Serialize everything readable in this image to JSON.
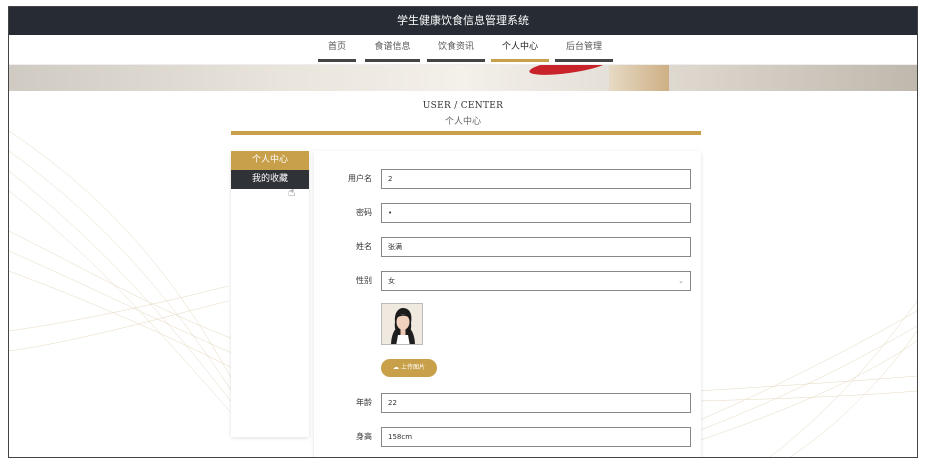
{
  "app": {
    "title": "学生健康饮食信息管理系统"
  },
  "nav": {
    "items": [
      {
        "label": "首页",
        "active": false
      },
      {
        "label": "食谱信息",
        "active": false
      },
      {
        "label": "饮食资讯",
        "active": false
      },
      {
        "label": "个人中心",
        "active": true
      },
      {
        "label": "后台管理",
        "active": false
      }
    ]
  },
  "section": {
    "title_en": "USER / CENTER",
    "title_cn": "个人中心"
  },
  "sidebar": {
    "items": [
      {
        "label": "个人中心"
      },
      {
        "label": "我的收藏"
      }
    ]
  },
  "form": {
    "username": {
      "label": "用户名",
      "value": "2"
    },
    "password": {
      "label": "密码",
      "value": "•"
    },
    "name": {
      "label": "姓名",
      "value": "张满"
    },
    "gender": {
      "label": "性别",
      "value": "女",
      "arrow": "⌄"
    },
    "upload": {
      "label": "上传图片",
      "icon": "cloud-upload-icon"
    },
    "age": {
      "label": "年龄",
      "value": "22"
    },
    "height": {
      "label": "身高",
      "value": "158cm"
    }
  },
  "colors": {
    "accent": "#c8a04a",
    "topbar": "#262b34",
    "sidebar_dark": "#2f3237"
  }
}
